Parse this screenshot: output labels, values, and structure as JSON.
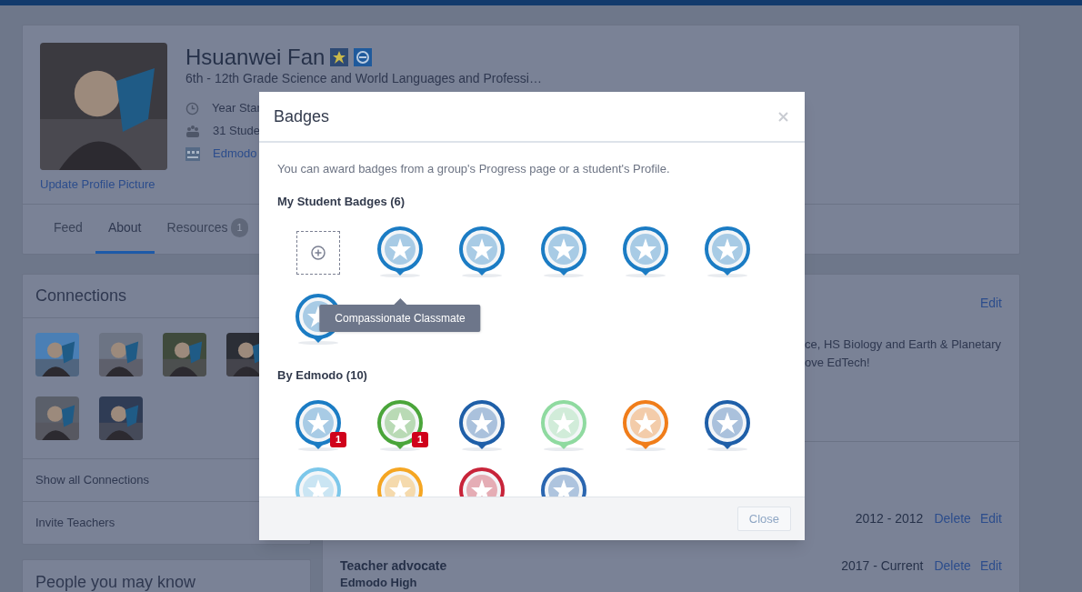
{
  "profile": {
    "name": "Hsuanwei Fan",
    "subtitle": "6th - 12th Grade Science and World Languages and Professi…",
    "info": [
      {
        "kind": "clock",
        "text": "Year Star"
      },
      {
        "kind": "students",
        "text": "31 Stude"
      },
      {
        "kind": "school",
        "text": "Edmodo"
      }
    ],
    "update_picture": "Update Profile Picture"
  },
  "tabs": [
    {
      "label": "Feed",
      "selected": false
    },
    {
      "label": "About",
      "selected": true
    },
    {
      "label": "Resources",
      "selected": false,
      "count": "1"
    }
  ],
  "connections": {
    "title": "Connections",
    "avatars": [
      {
        "kind": "picture"
      },
      {
        "kind": "picture"
      },
      {
        "kind": "picture"
      },
      {
        "kind": "picture"
      },
      {
        "kind": "picture"
      },
      {
        "kind": "picture"
      }
    ],
    "links": [
      "Show all Connections",
      "Invite Teachers"
    ]
  },
  "people_card": {
    "title": "People you may know"
  },
  "about": {
    "edit": "Edit",
    "bio_lines": [
      "ce, HS Biology and Earth & Planetary",
      "ove EdTech!"
    ]
  },
  "experience": [
    {
      "dates": "2012 - 2012",
      "actions": [
        "Delete",
        "Edit"
      ]
    },
    {
      "title": "Teacher advocate",
      "org": "Edmodo High",
      "dates": "2017 - Current",
      "actions": [
        "Delete",
        "Edit"
      ]
    }
  ],
  "modal": {
    "title": "Badges",
    "intro": "You can award badges from a group's Progress page or a student's Profile.",
    "sections": [
      {
        "title": "My Student Badges (6)",
        "badges": [
          {
            "kind": "add"
          },
          {
            "kind": "badge",
            "color": "#1b7cc4",
            "tooltip": "Compassionate Classmate"
          },
          {
            "kind": "badge",
            "color": "#1b7cc4"
          },
          {
            "kind": "badge",
            "color": "#1b7cc4"
          },
          {
            "kind": "badge",
            "color": "#1b7cc4"
          },
          {
            "kind": "badge",
            "color": "#1b7cc4"
          },
          {
            "kind": "badge",
            "color": "#1b7cc4"
          }
        ]
      },
      {
        "title": "By Edmodo (10)",
        "badges": [
          {
            "kind": "badge",
            "color": "#1b7cc4",
            "count": "1"
          },
          {
            "kind": "badge",
            "color": "#4aa53a",
            "count": "1"
          },
          {
            "kind": "badge",
            "color": "#1f5fa8"
          },
          {
            "kind": "badge",
            "color": "#8fdaa0"
          },
          {
            "kind": "badge",
            "color": "#f07d1a"
          },
          {
            "kind": "badge",
            "color": "#1f5fa8"
          },
          {
            "kind": "badge",
            "color": "#7cc7ea"
          },
          {
            "kind": "badge",
            "color": "#f5a623"
          },
          {
            "kind": "badge",
            "color": "#c8243a"
          },
          {
            "kind": "badge",
            "color": "#2a66b0"
          }
        ]
      }
    ],
    "close_button": {
      "label": "Close",
      "disabled": true
    }
  }
}
